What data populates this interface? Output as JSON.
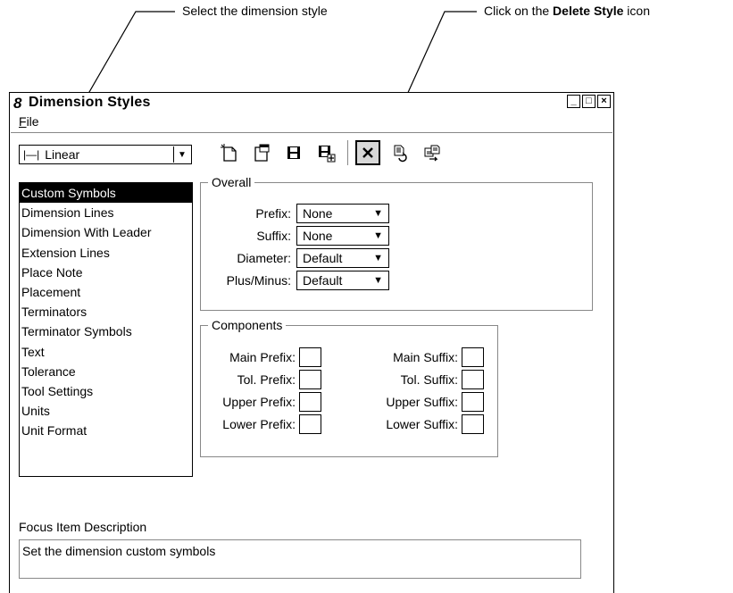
{
  "callouts": {
    "select_style": "Select the dimension style",
    "delete_prefix": "Click on the ",
    "delete_bold": "Delete Style",
    "delete_suffix": " icon"
  },
  "window": {
    "title": "Dimension Styles",
    "app_icon": "microstation-icon",
    "controls": {
      "minimize": "_",
      "maximize": "□",
      "close": "×"
    }
  },
  "menu": {
    "file_mnemonic": "F",
    "file_rest": "ile"
  },
  "style_combo": {
    "icon": "linear-dimension-icon",
    "value": "Linear"
  },
  "toolbar": {
    "icons": [
      "new-style-icon",
      "properties-icon",
      "save-icon",
      "save-as-icon",
      "delete-style-icon",
      "reset-icon",
      "compare-icon"
    ]
  },
  "categories": [
    "Custom Symbols",
    "Dimension Lines",
    "Dimension With Leader",
    "Extension Lines",
    "Place Note",
    "Placement",
    "Terminators",
    "Terminator Symbols",
    "Text",
    "Tolerance",
    "Tool Settings",
    "Units",
    "Unit Format"
  ],
  "overall": {
    "legend": "Overall",
    "prefix": {
      "label": "Prefix:",
      "value": "None"
    },
    "suffix": {
      "label": "Suffix:",
      "value": "None"
    },
    "diameter": {
      "label": "Diameter:",
      "value": "Default"
    },
    "plusminus": {
      "label": "Plus/Minus:",
      "value": "Default"
    }
  },
  "components": {
    "legend": "Components",
    "main_prefix": "Main Prefix:",
    "tol_prefix": "Tol. Prefix:",
    "upper_prefix": "Upper Prefix:",
    "lower_prefix": "Lower Prefix:",
    "main_suffix": "Main Suffix:",
    "tol_suffix": "Tol. Suffix:",
    "upper_suffix": "Upper Suffix:",
    "lower_suffix": "Lower Suffix:"
  },
  "focus": {
    "label": "Focus Item Description",
    "text": "Set the dimension custom symbols"
  }
}
